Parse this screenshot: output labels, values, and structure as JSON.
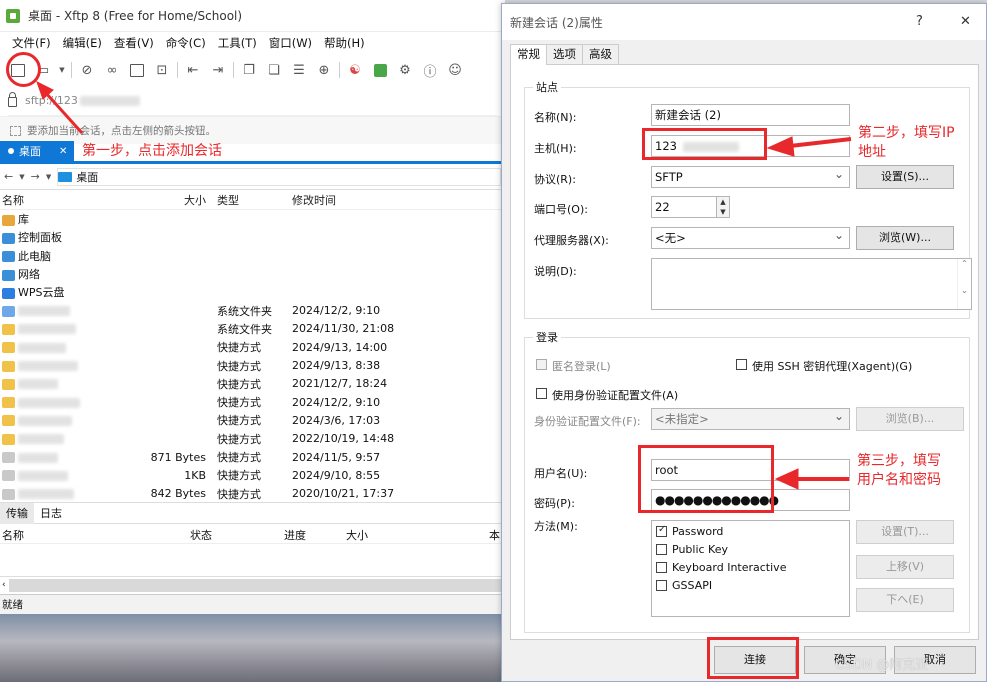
{
  "app": {
    "title": "桌面 - Xftp 8 (Free for Home/School)",
    "menu": [
      "文件(F)",
      "编辑(E)",
      "查看(V)",
      "命令(C)",
      "工具(T)",
      "窗口(W)",
      "帮助(H)"
    ],
    "address": "sftp://123",
    "hint": "要添加当前会话，点击左侧的箭头按钮。",
    "tab": "桌面",
    "path": "桌面",
    "columns": {
      "name": "名称",
      "size": "大小",
      "type": "类型",
      "date": "修改时间"
    },
    "rows": [
      {
        "name": "库",
        "size": "",
        "type": "",
        "date": "",
        "icon": "library-icon",
        "color": "#e8a73a"
      },
      {
        "name": "控制面板",
        "size": "",
        "type": "",
        "date": "",
        "icon": "control-panel-icon",
        "color": "#3a8fd8"
      },
      {
        "name": "此电脑",
        "size": "",
        "type": "",
        "date": "",
        "icon": "computer-icon",
        "color": "#3a8fd8"
      },
      {
        "name": "网络",
        "size": "",
        "type": "",
        "date": "",
        "icon": "network-icon",
        "color": "#3a8fd8"
      },
      {
        "name": "WPS云盘",
        "size": "",
        "type": "",
        "date": "",
        "icon": "cloud-icon",
        "color": "#2b7fe0"
      },
      {
        "name": "",
        "size": "",
        "type": "系统文件夹",
        "date": "2024/12/2, 9:10",
        "icon": "folder-icon",
        "color": "#6da9e8"
      },
      {
        "name": "",
        "size": "",
        "type": "系统文件夹",
        "date": "2024/11/30, 21:08",
        "icon": "folder-icon",
        "color": "#f0c24a"
      },
      {
        "name": "",
        "size": "",
        "type": "快捷方式",
        "date": "2024/9/13, 14:00",
        "icon": "shortcut-icon",
        "color": "#f0c24a"
      },
      {
        "name": "",
        "size": "",
        "type": "快捷方式",
        "date": "2024/9/13, 8:38",
        "icon": "shortcut-icon",
        "color": "#f0c24a"
      },
      {
        "name": "",
        "size": "",
        "type": "快捷方式",
        "date": "2021/12/7, 18:24",
        "icon": "shortcut-icon",
        "color": "#f0c24a"
      },
      {
        "name": "",
        "size": "",
        "type": "快捷方式",
        "date": "2024/12/2, 9:10",
        "icon": "shortcut-icon",
        "color": "#f0c24a"
      },
      {
        "name": "",
        "size": "",
        "type": "快捷方式",
        "date": "2024/3/6, 17:03",
        "icon": "shortcut-icon",
        "color": "#f0c24a"
      },
      {
        "name": "",
        "size": "",
        "type": "快捷方式",
        "date": "2022/10/19, 14:48",
        "icon": "shortcut-icon",
        "color": "#f0c24a"
      },
      {
        "name": "",
        "size": "871 Bytes",
        "type": "快捷方式",
        "date": "2024/11/5, 9:57",
        "icon": "shortcut-icon",
        "color": "#c9c9c9"
      },
      {
        "name": "",
        "size": "1KB",
        "type": "快捷方式",
        "date": "2024/9/10, 8:55",
        "icon": "shortcut-icon",
        "color": "#c9c9c9"
      },
      {
        "name": "",
        "size": "842 Bytes",
        "type": "快捷方式",
        "date": "2020/10/21, 17:37",
        "icon": "shortcut-icon",
        "color": "#c9c9c9"
      }
    ],
    "transfer_tabs": [
      "传输",
      "日志"
    ],
    "transfer_columns": [
      "名称",
      "状态",
      "进度",
      "大小",
      "本"
    ],
    "status": "就绪"
  },
  "dialog": {
    "title": "新建会话 (2)属性",
    "help": "?",
    "close": "✕",
    "tabs": [
      "常规",
      "选项",
      "高级"
    ],
    "site_group": "站点",
    "name_label": "名称(N):",
    "name_value": "新建会话 (2)",
    "host_label": "主机(H):",
    "host_value": "123",
    "protocol_label": "协议(R):",
    "protocol_value": "SFTP",
    "settings_btn": "设置(S)...",
    "port_label": "端口号(O):",
    "port_value": "22",
    "proxy_label": "代理服务器(X):",
    "proxy_value": "<无>",
    "browse_btn": "浏览(W)...",
    "desc_label": "说明(D):",
    "login_group": "登录",
    "anon_label": "匿名登录(L)",
    "ssh_agent_label": "使用 SSH 密钥代理(Xagent)(G)",
    "profile_label": "使用身份验证配置文件(A)",
    "profile_file_label": "身份验证配置文件(F):",
    "profile_file_value": "<未指定>",
    "profile_browse_btn": "浏览(B)...",
    "user_label": "用户名(U):",
    "user_value": "root",
    "pass_label": "密码(P):",
    "pass_value": "●●●●●●●●●●●●●",
    "method_label": "方法(M):",
    "methods": [
      {
        "label": "Password",
        "checked": true
      },
      {
        "label": "Public Key",
        "checked": false
      },
      {
        "label": "Keyboard Interactive",
        "checked": false
      },
      {
        "label": "GSSAPI",
        "checked": false
      }
    ],
    "method_settings_btn": "设置(T)...",
    "move_up_btn": "上移(V)",
    "move_down_btn": "下へ(E)",
    "connect_btn": "连接",
    "ok_btn": "确定",
    "cancel_btn": "取消"
  },
  "annotations": {
    "step1": "第一步，点击添加会话",
    "step2": "第二步，填写IP\n地址",
    "step3": "第三步，填写\n用户名和密码",
    "color": "#e8282b"
  },
  "watermark": "CSDN @阿克亚"
}
